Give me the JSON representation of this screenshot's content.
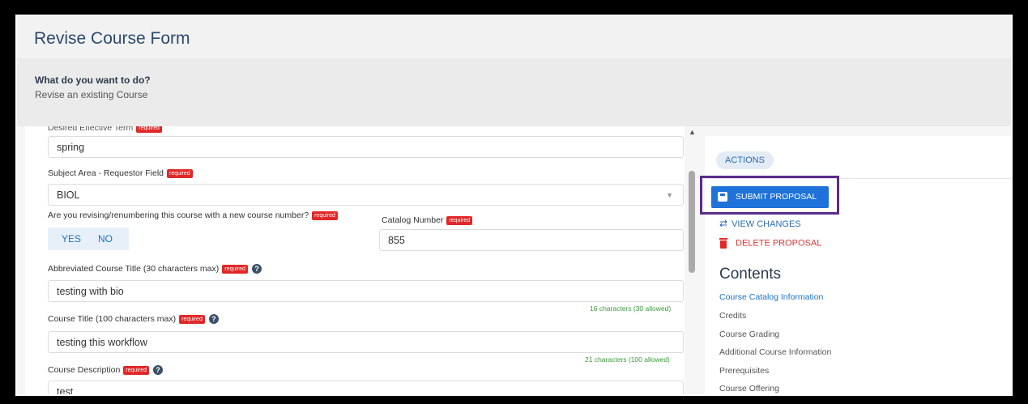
{
  "page_title": "Revise Course Form",
  "info": {
    "question": "What do you want to do?",
    "answer": "Revise an existing Course"
  },
  "form": {
    "effective_term": {
      "label": "Desired Effective Term",
      "required": "required",
      "value": "spring"
    },
    "subject_area": {
      "label": "Subject Area - Requestor Field",
      "required": "required",
      "value": "BIOL"
    },
    "renumber": {
      "label": "Are you revising/renumbering this course with a new course number?",
      "required": "required",
      "yes": "YES",
      "no": "NO"
    },
    "catalog_number": {
      "label": "Catalog Number",
      "required": "required",
      "value": "855"
    },
    "abbrev_title": {
      "label": "Abbreviated Course Title (30 characters max)",
      "required": "required",
      "value": "testing with bio",
      "count": "16 characters (30 allowed)"
    },
    "course_title": {
      "label": "Course Title (100 characters max)",
      "required": "required",
      "value": "testing this workflow",
      "count": "21 characters (100 allowed)"
    },
    "description": {
      "label": "Course Description",
      "required": "required",
      "value": "test"
    }
  },
  "actions": {
    "tab": "ACTIONS",
    "submit": "SUBMIT PROPOSAL",
    "view_changes": "VIEW CHANGES",
    "delete": "DELETE PROPOSAL"
  },
  "contents": {
    "heading": "Contents",
    "items": [
      "Course Catalog Information",
      "Credits",
      "Course Grading",
      "Additional Course Information",
      "Prerequisites",
      "Course Offering"
    ]
  },
  "colors": {
    "primary": "#1e72d9",
    "danger": "#e02828",
    "highlight": "#5b2b8a",
    "title": "#2b4a6f"
  }
}
